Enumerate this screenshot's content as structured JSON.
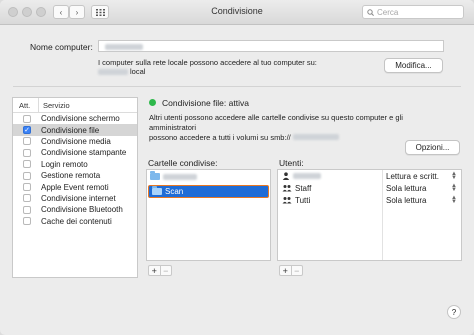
{
  "window": {
    "title": "Condivisione"
  },
  "toolbar": {
    "search_placeholder": "Cerca"
  },
  "computer": {
    "name_label": "Nome computer:",
    "info_line1": "I computer sulla rete locale possono accedere al tuo computer su:",
    "info_line2_suffix": "local",
    "modify_label": "Modifica..."
  },
  "services": {
    "header_on": "Att.",
    "header_service": "Servizio",
    "items": [
      {
        "label": "Condivisione schermo",
        "checked": false
      },
      {
        "label": "Condivisione file",
        "checked": true
      },
      {
        "label": "Condivisione media",
        "checked": false
      },
      {
        "label": "Condivisione stampante",
        "checked": false
      },
      {
        "label": "Login remoto",
        "checked": false
      },
      {
        "label": "Gestione remota",
        "checked": false
      },
      {
        "label": "Apple Event remoti",
        "checked": false
      },
      {
        "label": "Condivisione internet",
        "checked": false
      },
      {
        "label": "Condivisione Bluetooth",
        "checked": false
      },
      {
        "label": "Cache dei contenuti",
        "checked": false
      }
    ]
  },
  "status": {
    "text": "Condivisione file: attiva",
    "color": "#2eb84b",
    "description_line1": "Altri utenti possono accedere alle cartelle condivise su questo computer e gli amministratori",
    "description_line2": "possono accedere a tutti i volumi su smb://",
    "options_label": "Opzioni..."
  },
  "shared": {
    "label": "Cartelle condivise:",
    "folders": [
      {
        "label": ""
      },
      {
        "label": "Scan"
      }
    ]
  },
  "users": {
    "label": "Utenti:",
    "rows": [
      {
        "name": "",
        "permission": "Lettura e scritt.",
        "icon": "person-icon"
      },
      {
        "name": "Staff",
        "permission": "Sola lettura",
        "icon": "group-icon"
      },
      {
        "name": "Tutti",
        "permission": "Sola lettura",
        "icon": "group-icon"
      }
    ]
  },
  "buttons": {
    "add": "+",
    "remove": "−",
    "help": "?"
  }
}
